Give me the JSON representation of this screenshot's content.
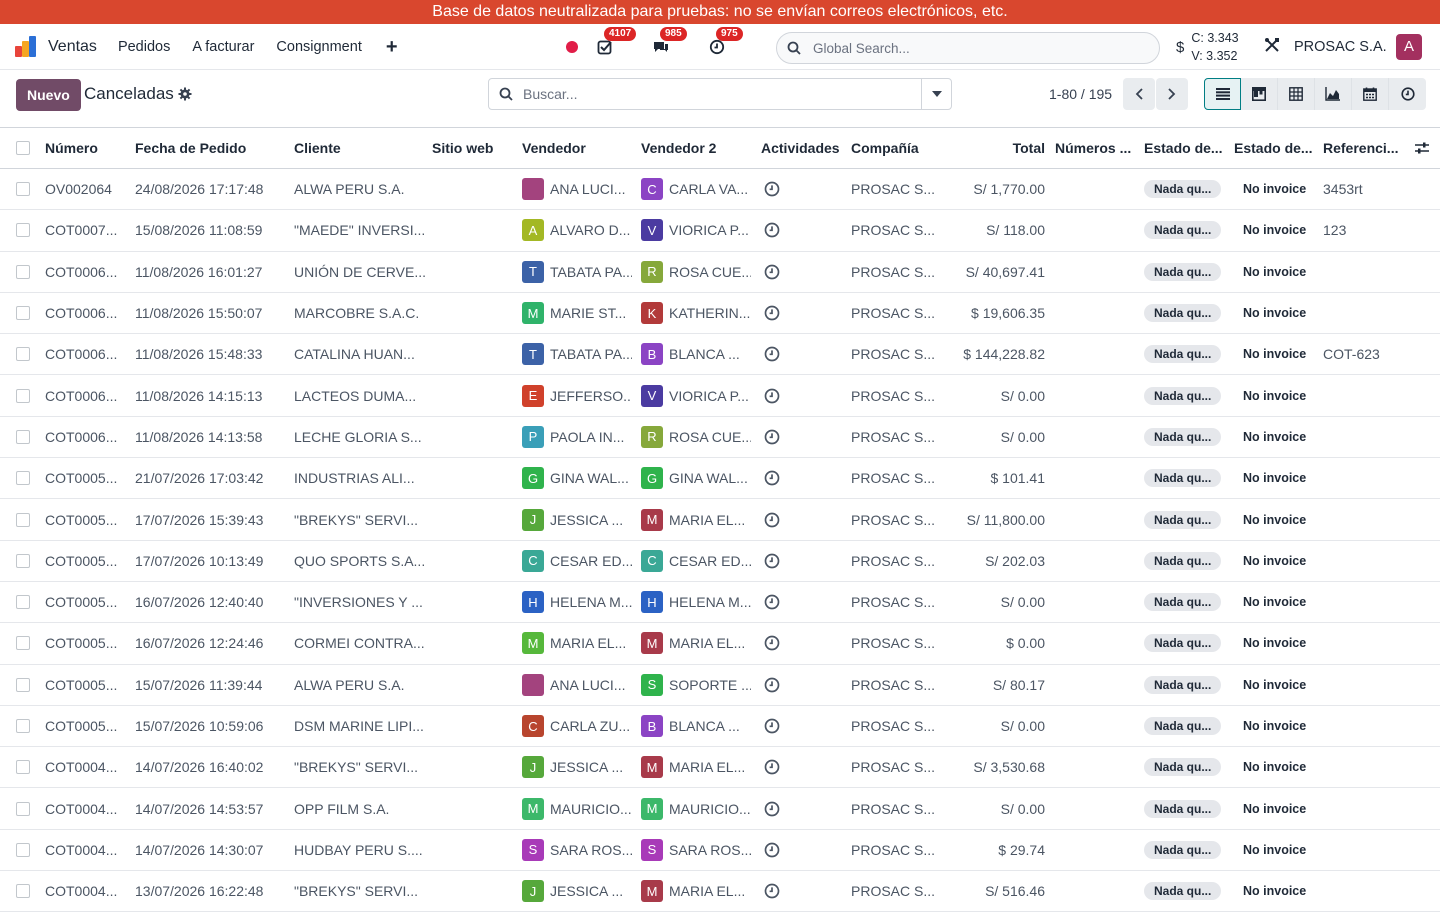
{
  "banner": "Base de datos neutralizada para pruebas: no se envían correos electrónicos, etc.",
  "nav": {
    "app_name": "Ventas",
    "menu": [
      "Pedidos",
      "A facturar",
      "Consignment"
    ],
    "plus": "+",
    "badges": {
      "activities": "4107",
      "messages": "985",
      "clock": "975"
    },
    "search_placeholder": "Global Search...",
    "currency_symbol": "$",
    "rate_buy": "C: 3.343",
    "rate_sell": "V: 3.352",
    "company": "PROSAC S.A.",
    "user_initial": "A"
  },
  "control": {
    "new_label": "Nuevo",
    "title": "Canceladas",
    "search_placeholder": "Buscar...",
    "pager": "1-80 / 195"
  },
  "columns": [
    "Número",
    "Fecha de Pedido",
    "Cliente",
    "Sitio web",
    "Vendedor",
    "Vendedor 2",
    "Actividades",
    "Compañía",
    "Total",
    "Números ...",
    "Estado de...",
    "Estado de...",
    "Referenci..."
  ],
  "rows": [
    {
      "num": "OV002064",
      "date": "24/08/2026 17:17:48",
      "cli": "ALWA PERU S.A.",
      "v1i": "",
      "v1c": "#a3437e",
      "v1": "ANA LUCI...",
      "v2i": "C",
      "v2c": "#8b44c4",
      "v2": "CARLA VA...",
      "comp": "PROSAC S...",
      "total": "S/ 1,770.00",
      "st": "Nada qu...",
      "inv": "No invoice",
      "ref": "3453rt"
    },
    {
      "num": "COT0007...",
      "date": "15/08/2026 11:08:59",
      "cli": "\"MAEDE\" INVERSI...",
      "v1i": "A",
      "v1c": "#a3b824",
      "v1": "ALVARO D...",
      "v2i": "V",
      "v2c": "#4b3ba1",
      "v2": "VIORICA P...",
      "comp": "PROSAC S...",
      "total": "S/ 118.00",
      "st": "Nada qu...",
      "inv": "No invoice",
      "ref": "123"
    },
    {
      "num": "COT0006...",
      "date": "11/08/2026 16:01:27",
      "cli": "UNIÓN DE CERVE...",
      "v1i": "T",
      "v1c": "#3c62a7",
      "v1": "TABATA PA...",
      "v2i": "R",
      "v2c": "#86a83b",
      "v2": "ROSA CUE...",
      "comp": "PROSAC S...",
      "total": "S/ 40,697.41",
      "st": "Nada qu...",
      "inv": "No invoice",
      "ref": ""
    },
    {
      "num": "COT0006...",
      "date": "11/08/2026 15:50:07",
      "cli": "MARCOBRE S.A.C.",
      "v1i": "M",
      "v1c": "#2fb36a",
      "v1": "MARIE ST...",
      "v2i": "K",
      "v2c": "#b23a3a",
      "v2": "KATHERIN...",
      "comp": "PROSAC S...",
      "total": "$ 19,606.35",
      "st": "Nada qu...",
      "inv": "No invoice",
      "ref": ""
    },
    {
      "num": "COT0006...",
      "date": "11/08/2026 15:48:33",
      "cli": "CATALINA HUAN...",
      "v1i": "T",
      "v1c": "#3c62a7",
      "v1": "TABATA PA...",
      "v2i": "B",
      "v2c": "#8b44c4",
      "v2": "BLANCA ...",
      "comp": "PROSAC S...",
      "total": "$ 144,228.82",
      "st": "Nada qu...",
      "inv": "No invoice",
      "ref": "COT-623"
    },
    {
      "num": "COT0006...",
      "date": "11/08/2026 14:15:13",
      "cli": "LACTEOS DUMA...",
      "v1i": "E",
      "v1c": "#d0412b",
      "v1": "JEFFERSO...",
      "v2i": "V",
      "v2c": "#4b3ba1",
      "v2": "VIORICA P...",
      "comp": "PROSAC S...",
      "total": "S/ 0.00",
      "st": "Nada qu...",
      "inv": "No invoice",
      "ref": ""
    },
    {
      "num": "COT0006...",
      "date": "11/08/2026 14:13:58",
      "cli": "LECHE GLORIA S...",
      "v1i": "P",
      "v1c": "#3a9fb8",
      "v1": "PAOLA IN...",
      "v2i": "R",
      "v2c": "#86a83b",
      "v2": "ROSA CUE...",
      "comp": "PROSAC S...",
      "total": "S/ 0.00",
      "st": "Nada qu...",
      "inv": "No invoice",
      "ref": ""
    },
    {
      "num": "COT0005...",
      "date": "21/07/2026 17:03:42",
      "cli": "INDUSTRIAS ALI...",
      "v1i": "G",
      "v1c": "#2fb34c",
      "v1": "GINA WAL...",
      "v2i": "G",
      "v2c": "#2fb34c",
      "v2": "GINA WAL...",
      "comp": "PROSAC S...",
      "total": "$ 101.41",
      "st": "Nada qu...",
      "inv": "No invoice",
      "ref": ""
    },
    {
      "num": "COT0005...",
      "date": "17/07/2026 15:39:43",
      "cli": "\"BREKYS\" SERVI...",
      "v1i": "J",
      "v1c": "#56a83b",
      "v1": "JESSICA ...",
      "v2i": "M",
      "v2c": "#a83a4a",
      "v2": "MARIA EL...",
      "comp": "PROSAC S...",
      "total": "S/ 11,800.00",
      "st": "Nada qu...",
      "inv": "No invoice",
      "ref": ""
    },
    {
      "num": "COT0005...",
      "date": "17/07/2026 10:13:49",
      "cli": "QUO SPORTS S.A...",
      "v1i": "C",
      "v1c": "#3aa896",
      "v1": "CESAR ED...",
      "v2i": "C",
      "v2c": "#3aa896",
      "v2": "CESAR ED...",
      "comp": "PROSAC S...",
      "total": "S/ 202.03",
      "st": "Nada qu...",
      "inv": "No invoice",
      "ref": ""
    },
    {
      "num": "COT0005...",
      "date": "16/07/2026 12:40:40",
      "cli": "\"INVERSIONES Y ...",
      "v1i": "H",
      "v1c": "#2b62c4",
      "v1": "HELENA M...",
      "v2i": "H",
      "v2c": "#2b62c4",
      "v2": "HELENA M...",
      "comp": "PROSAC S...",
      "total": "S/ 0.00",
      "st": "Nada qu...",
      "inv": "No invoice",
      "ref": ""
    },
    {
      "num": "COT0005...",
      "date": "16/07/2026 12:24:46",
      "cli": "CORMEI CONTRA...",
      "v1i": "M",
      "v1c": "#56b83b",
      "v1": "MARIA EL...",
      "v2i": "M",
      "v2c": "#a83a4a",
      "v2": "MARIA EL...",
      "comp": "PROSAC S...",
      "total": "$ 0.00",
      "st": "Nada qu...",
      "inv": "No invoice",
      "ref": ""
    },
    {
      "num": "COT0005...",
      "date": "15/07/2026 11:39:44",
      "cli": "ALWA PERU S.A.",
      "v1i": "",
      "v1c": "#a3437e",
      "v1": "ANA LUCI...",
      "v2i": "S",
      "v2c": "#2fb34c",
      "v2": "SOPORTE ...",
      "comp": "PROSAC S...",
      "total": "S/ 80.17",
      "st": "Nada qu...",
      "inv": "No invoice",
      "ref": ""
    },
    {
      "num": "COT0005...",
      "date": "15/07/2026 10:59:06",
      "cli": "DSM MARINE LIPI...",
      "v1i": "C",
      "v1c": "#b8452e",
      "v1": "CARLA ZU...",
      "v2i": "B",
      "v2c": "#8b44c4",
      "v2": "BLANCA ...",
      "comp": "PROSAC S...",
      "total": "S/ 0.00",
      "st": "Nada qu...",
      "inv": "No invoice",
      "ref": ""
    },
    {
      "num": "COT0004...",
      "date": "14/07/2026 16:40:02",
      "cli": "\"BREKYS\" SERVI...",
      "v1i": "J",
      "v1c": "#56a83b",
      "v1": "JESSICA ...",
      "v2i": "M",
      "v2c": "#a83a4a",
      "v2": "MARIA EL...",
      "comp": "PROSAC S...",
      "total": "S/ 3,530.68",
      "st": "Nada qu...",
      "inv": "No invoice",
      "ref": ""
    },
    {
      "num": "COT0004...",
      "date": "14/07/2026 14:53:57",
      "cli": "OPP FILM S.A.",
      "v1i": "M",
      "v1c": "#3cb86a",
      "v1": "MAURICIO...",
      "v2i": "M",
      "v2c": "#3cb86a",
      "v2": "MAURICIO...",
      "comp": "PROSAC S...",
      "total": "S/ 0.00",
      "st": "Nada qu...",
      "inv": "No invoice",
      "ref": ""
    },
    {
      "num": "COT0004...",
      "date": "14/07/2026 14:30:07",
      "cli": "HUDBAY PERU S....",
      "v1i": "S",
      "v1c": "#a83ab8",
      "v1": "SARA ROS...",
      "v2i": "S",
      "v2c": "#a83ab8",
      "v2": "SARA ROS...",
      "comp": "PROSAC S...",
      "total": "$ 29.74",
      "st": "Nada qu...",
      "inv": "No invoice",
      "ref": ""
    },
    {
      "num": "COT0004...",
      "date": "13/07/2026 16:22:48",
      "cli": "\"BREKYS\" SERVI...",
      "v1i": "J",
      "v1c": "#56a83b",
      "v1": "JESSICA ...",
      "v2i": "M",
      "v2c": "#a83a4a",
      "v2": "MARIA EL...",
      "comp": "PROSAC S...",
      "total": "S/ 516.46",
      "st": "Nada qu...",
      "inv": "No invoice",
      "ref": ""
    }
  ]
}
